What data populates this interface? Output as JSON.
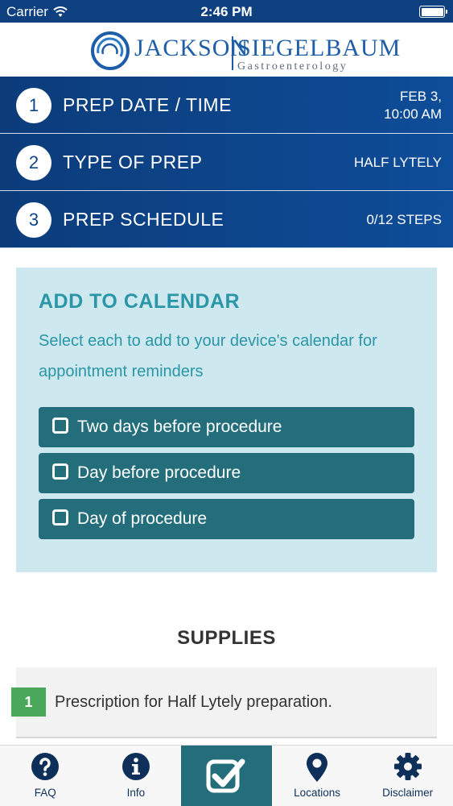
{
  "status_bar": {
    "carrier": "Carrier",
    "time": "2:46 PM"
  },
  "header": {
    "logo_main": "JACKSON SIEGELBAUM",
    "logo_left": "JACKSON",
    "logo_right": "SIEGELBAUM",
    "logo_sub": "Gastroenterology"
  },
  "steps": [
    {
      "number": "1",
      "title": "PREP DATE / TIME",
      "value": "FEB 3,\n10:00 AM"
    },
    {
      "number": "2",
      "title": "TYPE OF PREP",
      "value": "HALF LYTELY"
    },
    {
      "number": "3",
      "title": "PREP SCHEDULE",
      "value": "0/12 STEPS"
    }
  ],
  "calendar": {
    "title": "ADD TO CALENDAR",
    "description": "Select each to add to your device's calendar for appointment reminders",
    "options": [
      {
        "label": "Two days before procedure",
        "checked": false
      },
      {
        "label": "Day before procedure",
        "checked": false
      },
      {
        "label": "Day of procedure",
        "checked": false
      }
    ]
  },
  "supplies": {
    "title": "SUPPLIES",
    "items": [
      {
        "number": "1",
        "text": "Prescription for Half Lytely preparation."
      }
    ]
  },
  "tabbar": {
    "tabs": [
      {
        "label": "FAQ",
        "icon": "question-circle-icon"
      },
      {
        "label": "Info",
        "icon": "info-circle-icon"
      },
      {
        "label": "",
        "icon": "checkbox-checked-icon",
        "active": true
      },
      {
        "label": "Locations",
        "icon": "map-pin-icon"
      },
      {
        "label": "Disclaimer",
        "icon": "gear-icon"
      }
    ]
  },
  "colors": {
    "brand_blue": "#0e4588",
    "teal": "#246e7b",
    "calendar_bg": "#cde8ee",
    "accent_text": "#2a96a8",
    "supply_badge": "#4aa85a"
  }
}
